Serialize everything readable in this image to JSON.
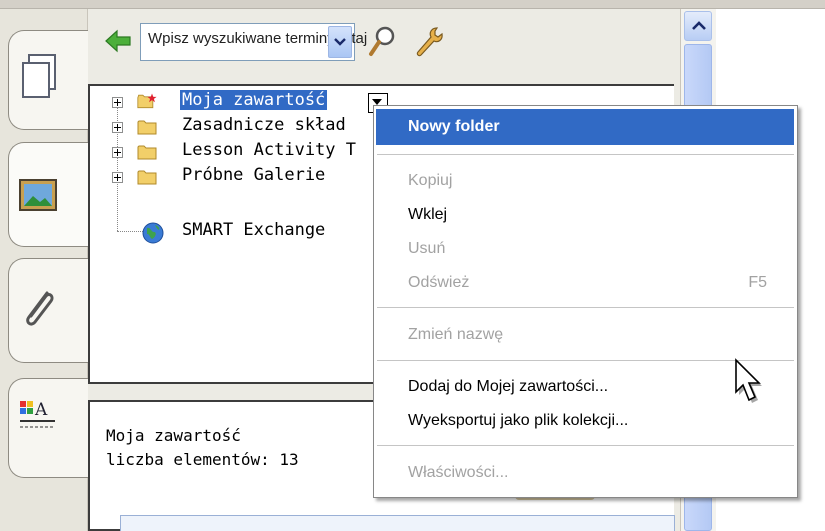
{
  "search": {
    "placeholder": "Wpisz wyszukiwane terminy tutaj"
  },
  "tree": {
    "items": [
      {
        "label": "Moja zawartość",
        "icon": "folder-star-icon",
        "selected": true
      },
      {
        "label": "Zasadnicze skład",
        "icon": "folder-icon"
      },
      {
        "label": "Lesson Activity T",
        "icon": "folder-icon"
      },
      {
        "label": "Próbne Galerie",
        "icon": "folder-icon"
      },
      {
        "label": "SMART Exchange",
        "icon": "globe-icon"
      }
    ]
  },
  "info": {
    "title": "Moja zawartość",
    "count": "liczba elementów: 13"
  },
  "context_menu": {
    "items": [
      {
        "label": "Nowy folder",
        "bold": true,
        "highlighted": true
      },
      {
        "label": "Kopiuj",
        "disabled": true
      },
      {
        "label": "Wklej",
        "disabled": false
      },
      {
        "label": "Usuń",
        "disabled": true
      },
      {
        "label": "Odśwież",
        "disabled": true,
        "shortcut": "F5"
      },
      {
        "label": "Zmień nazwę",
        "disabled": true
      },
      {
        "label": "Dodaj do Mojej zawartości...",
        "disabled": false
      },
      {
        "label": "Wyeksportuj jako plik kolekcji...",
        "disabled": false
      },
      {
        "label": "Właściwości...",
        "disabled": true
      }
    ]
  },
  "colors": {
    "selection": "#316ac5",
    "disabled_text": "#a2a2a2",
    "panel_bg": "#ecebe4"
  }
}
